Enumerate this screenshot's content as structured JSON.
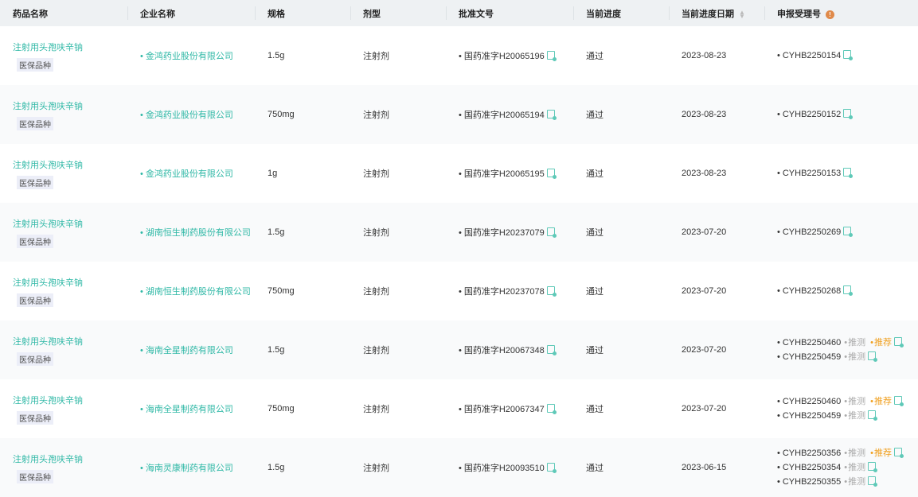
{
  "headers": [
    "药品名称",
    "企业名称",
    "规格",
    "剂型",
    "批准文号",
    "当前进度",
    "当前进度日期",
    "申报受理号"
  ],
  "labels": {
    "tag": "医保品种",
    "guess": "推测",
    "recommend": "推荐"
  },
  "rows": [
    {
      "drug": "注射用头孢呋辛钠",
      "company": "金鸿药业股份有限公司",
      "spec": "1.5g",
      "form": "注射剂",
      "approval": "国药准字H20065196",
      "progress": "通过",
      "date": "2023-08-23",
      "apps": [
        {
          "no": "CYHB2250154"
        }
      ]
    },
    {
      "drug": "注射用头孢呋辛钠",
      "company": "金鸿药业股份有限公司",
      "spec": "750mg",
      "form": "注射剂",
      "approval": "国药准字H20065194",
      "progress": "通过",
      "date": "2023-08-23",
      "apps": [
        {
          "no": "CYHB2250152"
        }
      ]
    },
    {
      "drug": "注射用头孢呋辛钠",
      "company": "金鸿药业股份有限公司",
      "spec": "1g",
      "form": "注射剂",
      "approval": "国药准字H20065195",
      "progress": "通过",
      "date": "2023-08-23",
      "apps": [
        {
          "no": "CYHB2250153"
        }
      ]
    },
    {
      "drug": "注射用头孢呋辛钠",
      "company": "湖南恒生制药股份有限公司",
      "spec": "1.5g",
      "form": "注射剂",
      "approval": "国药准字H20237079",
      "progress": "通过",
      "date": "2023-07-20",
      "apps": [
        {
          "no": "CYHB2250269"
        }
      ]
    },
    {
      "drug": "注射用头孢呋辛钠",
      "company": "湖南恒生制药股份有限公司",
      "spec": "750mg",
      "form": "注射剂",
      "approval": "国药准字H20237078",
      "progress": "通过",
      "date": "2023-07-20",
      "apps": [
        {
          "no": "CYHB2250268"
        }
      ]
    },
    {
      "drug": "注射用头孢呋辛钠",
      "company": "海南全星制药有限公司",
      "spec": "1.5g",
      "form": "注射剂",
      "approval": "国药准字H20067348",
      "progress": "通过",
      "date": "2023-07-20",
      "apps": [
        {
          "no": "CYHB2250460",
          "guess": true,
          "rec": true
        },
        {
          "no": "CYHB2250459",
          "guess": true
        }
      ]
    },
    {
      "drug": "注射用头孢呋辛钠",
      "company": "海南全星制药有限公司",
      "spec": "750mg",
      "form": "注射剂",
      "approval": "国药准字H20067347",
      "progress": "通过",
      "date": "2023-07-20",
      "apps": [
        {
          "no": "CYHB2250460",
          "guess": true,
          "rec": true
        },
        {
          "no": "CYHB2250459",
          "guess": true
        }
      ]
    },
    {
      "drug": "注射用头孢呋辛钠",
      "company": "海南灵康制药有限公司",
      "spec": "1.5g",
      "form": "注射剂",
      "approval": "国药准字H20093510",
      "progress": "通过",
      "date": "2023-06-15",
      "apps": [
        {
          "no": "CYHB2250356",
          "guess": true,
          "rec": true
        },
        {
          "no": "CYHB2250354",
          "guess": true
        },
        {
          "no": "CYHB2250355",
          "guess": true
        }
      ]
    }
  ]
}
